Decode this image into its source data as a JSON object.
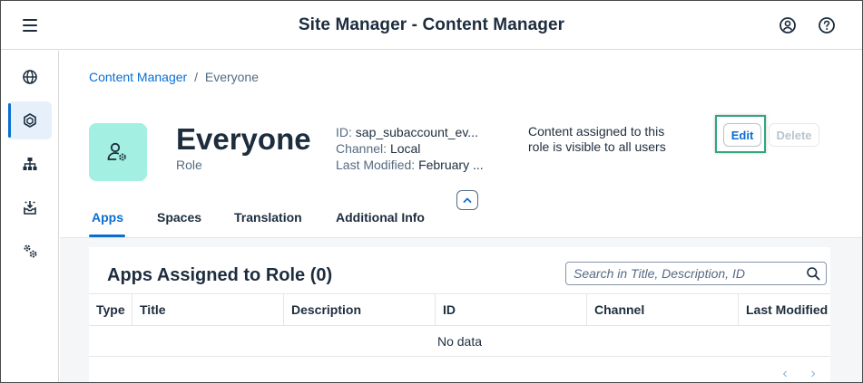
{
  "shell": {
    "title": "Site Manager - Content Manager",
    "icons": [
      "menu-icon",
      "user-icon",
      "help-icon"
    ]
  },
  "sidenav": {
    "items": [
      {
        "icon": "globe-icon",
        "active": false
      },
      {
        "icon": "content-cube-icon",
        "active": true
      },
      {
        "icon": "hierarchy-icon",
        "active": false
      },
      {
        "icon": "inbox-download-icon",
        "active": false
      },
      {
        "icon": "settings-gears-icon",
        "active": false
      }
    ]
  },
  "breadcrumb": {
    "link": "Content Manager",
    "separator": "/",
    "current": "Everyone"
  },
  "header": {
    "title": "Everyone",
    "subtitle": "Role",
    "avatar_icon": "user-settings-icon",
    "attributes": {
      "id_label": "ID:",
      "id_value": "sap_subaccount_ev...",
      "channel_label": "Channel:",
      "channel_value": "Local",
      "modified_label": "Last Modified:",
      "modified_value": "February ..."
    },
    "description": "Content assigned to this role is visible to all users",
    "edit_label": "Edit",
    "delete_label": "Delete"
  },
  "tabs": [
    {
      "label": "Apps",
      "selected": true
    },
    {
      "label": "Spaces",
      "selected": false
    },
    {
      "label": "Translation",
      "selected": false
    },
    {
      "label": "Additional Info",
      "selected": false
    }
  ],
  "table": {
    "title": "Apps Assigned to Role (0)",
    "search_placeholder": "Search in Title, Description, ID",
    "columns": [
      "Type",
      "Title",
      "Description",
      "ID",
      "Channel",
      "Last Modified"
    ],
    "empty_text": "No data"
  },
  "colors": {
    "accent": "#0a6ed1",
    "avatar_bg": "#a3efe1",
    "highlight": "#2fa77a"
  }
}
